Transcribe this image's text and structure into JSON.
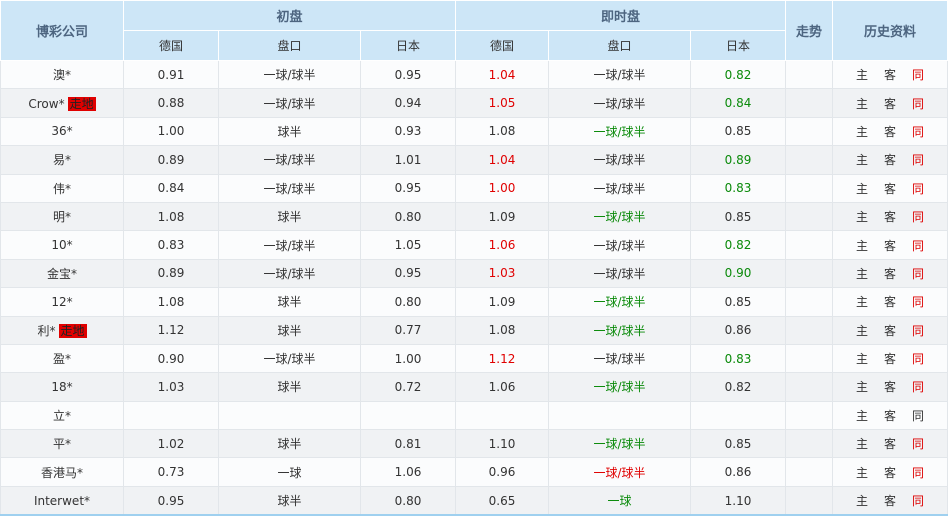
{
  "header": {
    "company": "博彩公司",
    "initial": "初盘",
    "live": "即时盘",
    "trend": "走势",
    "history": "历史资料",
    "sub": {
      "home": "德国",
      "handicap": "盘口",
      "away": "日本"
    }
  },
  "links": {
    "home": "主",
    "away": "客",
    "same": "同"
  },
  "colors": {
    "red": "#e00000",
    "green": "#0a8a0a",
    "header_bg": "#cde6f7"
  },
  "rows": [
    {
      "name": "澳*",
      "badge": "",
      "i": [
        "0.91",
        "一球/球半",
        "0.95"
      ],
      "l": [
        "1.04",
        "一球/球半",
        "0.82"
      ],
      "c": [
        "red",
        "",
        "green"
      ],
      "same_red": true
    },
    {
      "name": "Crow*",
      "badge": "走地",
      "i": [
        "0.88",
        "一球/球半",
        "0.94"
      ],
      "l": [
        "1.05",
        "一球/球半",
        "0.84"
      ],
      "c": [
        "red",
        "",
        "green"
      ],
      "same_red": true
    },
    {
      "name": "36*",
      "badge": "",
      "i": [
        "1.00",
        "球半",
        "0.93"
      ],
      "l": [
        "1.08",
        "一球/球半",
        "0.85"
      ],
      "c": [
        "",
        "green",
        ""
      ],
      "same_red": true
    },
    {
      "name": "易*",
      "badge": "",
      "i": [
        "0.89",
        "一球/球半",
        "1.01"
      ],
      "l": [
        "1.04",
        "一球/球半",
        "0.89"
      ],
      "c": [
        "red",
        "",
        "green"
      ],
      "same_red": true
    },
    {
      "name": "伟*",
      "badge": "",
      "i": [
        "0.84",
        "一球/球半",
        "0.95"
      ],
      "l": [
        "1.00",
        "一球/球半",
        "0.83"
      ],
      "c": [
        "red",
        "",
        "green"
      ],
      "same_red": true
    },
    {
      "name": "明*",
      "badge": "",
      "i": [
        "1.08",
        "球半",
        "0.80"
      ],
      "l": [
        "1.09",
        "一球/球半",
        "0.85"
      ],
      "c": [
        "",
        "green",
        ""
      ],
      "same_red": true
    },
    {
      "name": "10*",
      "badge": "",
      "i": [
        "0.83",
        "一球/球半",
        "1.05"
      ],
      "l": [
        "1.06",
        "一球/球半",
        "0.82"
      ],
      "c": [
        "red",
        "",
        "green"
      ],
      "same_red": true
    },
    {
      "name": "金宝*",
      "badge": "",
      "i": [
        "0.89",
        "一球/球半",
        "0.95"
      ],
      "l": [
        "1.03",
        "一球/球半",
        "0.90"
      ],
      "c": [
        "red",
        "",
        "green"
      ],
      "same_red": true
    },
    {
      "name": "12*",
      "badge": "",
      "i": [
        "1.08",
        "球半",
        "0.80"
      ],
      "l": [
        "1.09",
        "一球/球半",
        "0.85"
      ],
      "c": [
        "",
        "green",
        ""
      ],
      "same_red": true
    },
    {
      "name": "利*",
      "badge": "走地",
      "i": [
        "1.12",
        "球半",
        "0.77"
      ],
      "l": [
        "1.08",
        "一球/球半",
        "0.86"
      ],
      "c": [
        "",
        "green",
        ""
      ],
      "same_red": true
    },
    {
      "name": "盈*",
      "badge": "",
      "i": [
        "0.90",
        "一球/球半",
        "1.00"
      ],
      "l": [
        "1.12",
        "一球/球半",
        "0.83"
      ],
      "c": [
        "red",
        "",
        "green"
      ],
      "same_red": true
    },
    {
      "name": "18*",
      "badge": "",
      "i": [
        "1.03",
        "球半",
        "0.72"
      ],
      "l": [
        "1.06",
        "一球/球半",
        "0.82"
      ],
      "c": [
        "",
        "green",
        ""
      ],
      "same_red": true
    },
    {
      "name": "立*",
      "badge": "",
      "i": [
        "",
        "",
        ""
      ],
      "l": [
        "",
        "",
        ""
      ],
      "c": [
        "",
        "",
        ""
      ],
      "same_red": false
    },
    {
      "name": "平*",
      "badge": "",
      "i": [
        "1.02",
        "球半",
        "0.81"
      ],
      "l": [
        "1.10",
        "一球/球半",
        "0.85"
      ],
      "c": [
        "",
        "green",
        ""
      ],
      "same_red": true
    },
    {
      "name": "香港马*",
      "badge": "",
      "i": [
        "0.73",
        "一球",
        "1.06"
      ],
      "l": [
        "0.96",
        "一球/球半",
        "0.86"
      ],
      "c": [
        "",
        "red",
        ""
      ],
      "same_red": true
    },
    {
      "name": "Interwet*",
      "badge": "",
      "i": [
        "0.95",
        "球半",
        "0.80"
      ],
      "l": [
        "0.65",
        "一球",
        "1.10"
      ],
      "c": [
        "",
        "green",
        ""
      ],
      "same_red": true
    }
  ]
}
